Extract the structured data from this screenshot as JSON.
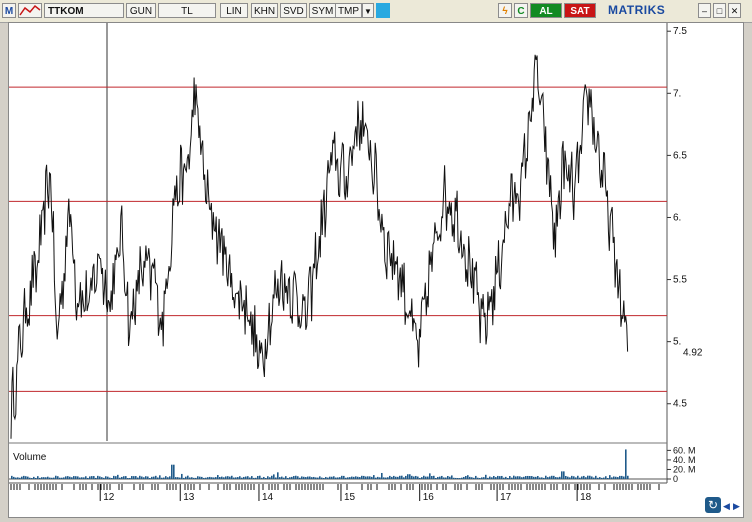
{
  "toolbar": {
    "app_letter": "M",
    "symbol": "TTKOM",
    "period": "GUN",
    "currency": "TL",
    "scale": "LIN",
    "buttons": [
      "KHN",
      "SVD",
      "SYM",
      "TMP"
    ],
    "buy_label": "AL",
    "sell_label": "SAT",
    "brand": "MATRIKS"
  },
  "chart_data": {
    "type": "line",
    "title": "",
    "ylim": [
      4.2,
      7.55
    ],
    "y_ticks": [
      "7.5",
      "7.",
      "6.5",
      "6.",
      "5.5",
      "5.",
      "4.5"
    ],
    "y_tick_values": [
      7.5,
      7.0,
      6.5,
      6.0,
      5.5,
      5.0,
      4.5
    ],
    "last_price_label": "4.92",
    "last_price": 4.92,
    "x_labels": [
      "12",
      "13",
      "14",
      "15",
      "16",
      "17",
      "18"
    ],
    "x_label_positions_index": [
      0.136,
      0.258,
      0.378,
      0.503,
      0.623,
      0.741,
      0.863
    ],
    "horizontal_levels": [
      7.05,
      6.13,
      5.21,
      4.6
    ],
    "level_color": "#c0272d",
    "line_color": "#111111",
    "anchors": [
      [
        0.0,
        4.4
      ],
      [
        0.02,
        5.2
      ],
      [
        0.04,
        5.6
      ],
      [
        0.06,
        6.4
      ],
      [
        0.07,
        5.0
      ],
      [
        0.09,
        6.1
      ],
      [
        0.1,
        5.4
      ],
      [
        0.12,
        5.3
      ],
      [
        0.135,
        5.7
      ],
      [
        0.15,
        5.3
      ],
      [
        0.17,
        5.9
      ],
      [
        0.18,
        5.1
      ],
      [
        0.2,
        5.6
      ],
      [
        0.22,
        5.5
      ],
      [
        0.23,
        5.1
      ],
      [
        0.25,
        6.2
      ],
      [
        0.27,
        6.4
      ],
      [
        0.28,
        7.0
      ],
      [
        0.3,
        6.1
      ],
      [
        0.32,
        5.8
      ],
      [
        0.34,
        5.4
      ],
      [
        0.36,
        5.3
      ],
      [
        0.38,
        4.8
      ],
      [
        0.39,
        5.1
      ],
      [
        0.41,
        5.5
      ],
      [
        0.43,
        5.4
      ],
      [
        0.45,
        5.2
      ],
      [
        0.47,
        5.8
      ],
      [
        0.49,
        6.5
      ],
      [
        0.51,
        6.3
      ],
      [
        0.53,
        6.8
      ],
      [
        0.55,
        6.5
      ],
      [
        0.57,
        5.8
      ],
      [
        0.59,
        5.6
      ],
      [
        0.61,
        5.2
      ],
      [
        0.62,
        4.9
      ],
      [
        0.64,
        5.6
      ],
      [
        0.66,
        6.2
      ],
      [
        0.68,
        6.0
      ],
      [
        0.7,
        5.6
      ],
      [
        0.72,
        5.1
      ],
      [
        0.74,
        5.5
      ],
      [
        0.76,
        6.1
      ],
      [
        0.78,
        6.3
      ],
      [
        0.8,
        7.2
      ],
      [
        0.81,
        6.8
      ],
      [
        0.83,
        5.8
      ],
      [
        0.84,
        6.4
      ],
      [
        0.86,
        6.2
      ],
      [
        0.88,
        7.0
      ],
      [
        0.9,
        6.4
      ],
      [
        0.92,
        5.7
      ],
      [
        0.94,
        4.92
      ]
    ],
    "volume": {
      "label": "Volume",
      "ylim": [
        0,
        65
      ],
      "y_ticks": [
        "60. M",
        "40. M",
        "20. M",
        "0"
      ],
      "y_tick_values": [
        60,
        40,
        20,
        0
      ],
      "bar_color": "#1f5a8a",
      "spikes": [
        [
          0.245,
          30
        ],
        [
          0.405,
          14
        ],
        [
          0.605,
          10
        ],
        [
          0.84,
          16
        ],
        [
          0.935,
          62
        ]
      ]
    }
  }
}
